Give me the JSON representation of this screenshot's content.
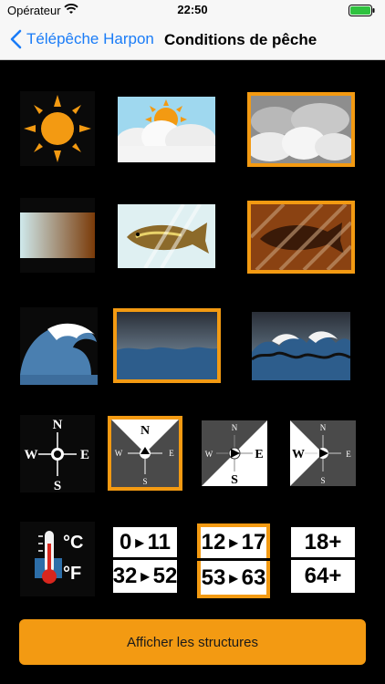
{
  "status": {
    "carrier": "Opérateur",
    "time": "22:50"
  },
  "nav": {
    "back_label": "Télépêche Harpon",
    "title": "Conditions de pêche"
  },
  "compass": {
    "n": "N",
    "s": "S",
    "e": "E",
    "w": "W"
  },
  "temperature": {
    "celsius": "°C",
    "fahrenheit": "°F"
  },
  "ranges": [
    {
      "top_a": "0",
      "top_b": "11",
      "bottom_a": "32",
      "bottom_b": "52"
    },
    {
      "top_a": "12",
      "top_b": "17",
      "bottom_a": "53",
      "bottom_b": "63"
    },
    {
      "top": "18+",
      "bottom": "64+"
    }
  ],
  "action_button": {
    "label": "Afficher les structures"
  },
  "colors": {
    "accent": "#f39a12",
    "link": "#1a7cf7"
  }
}
